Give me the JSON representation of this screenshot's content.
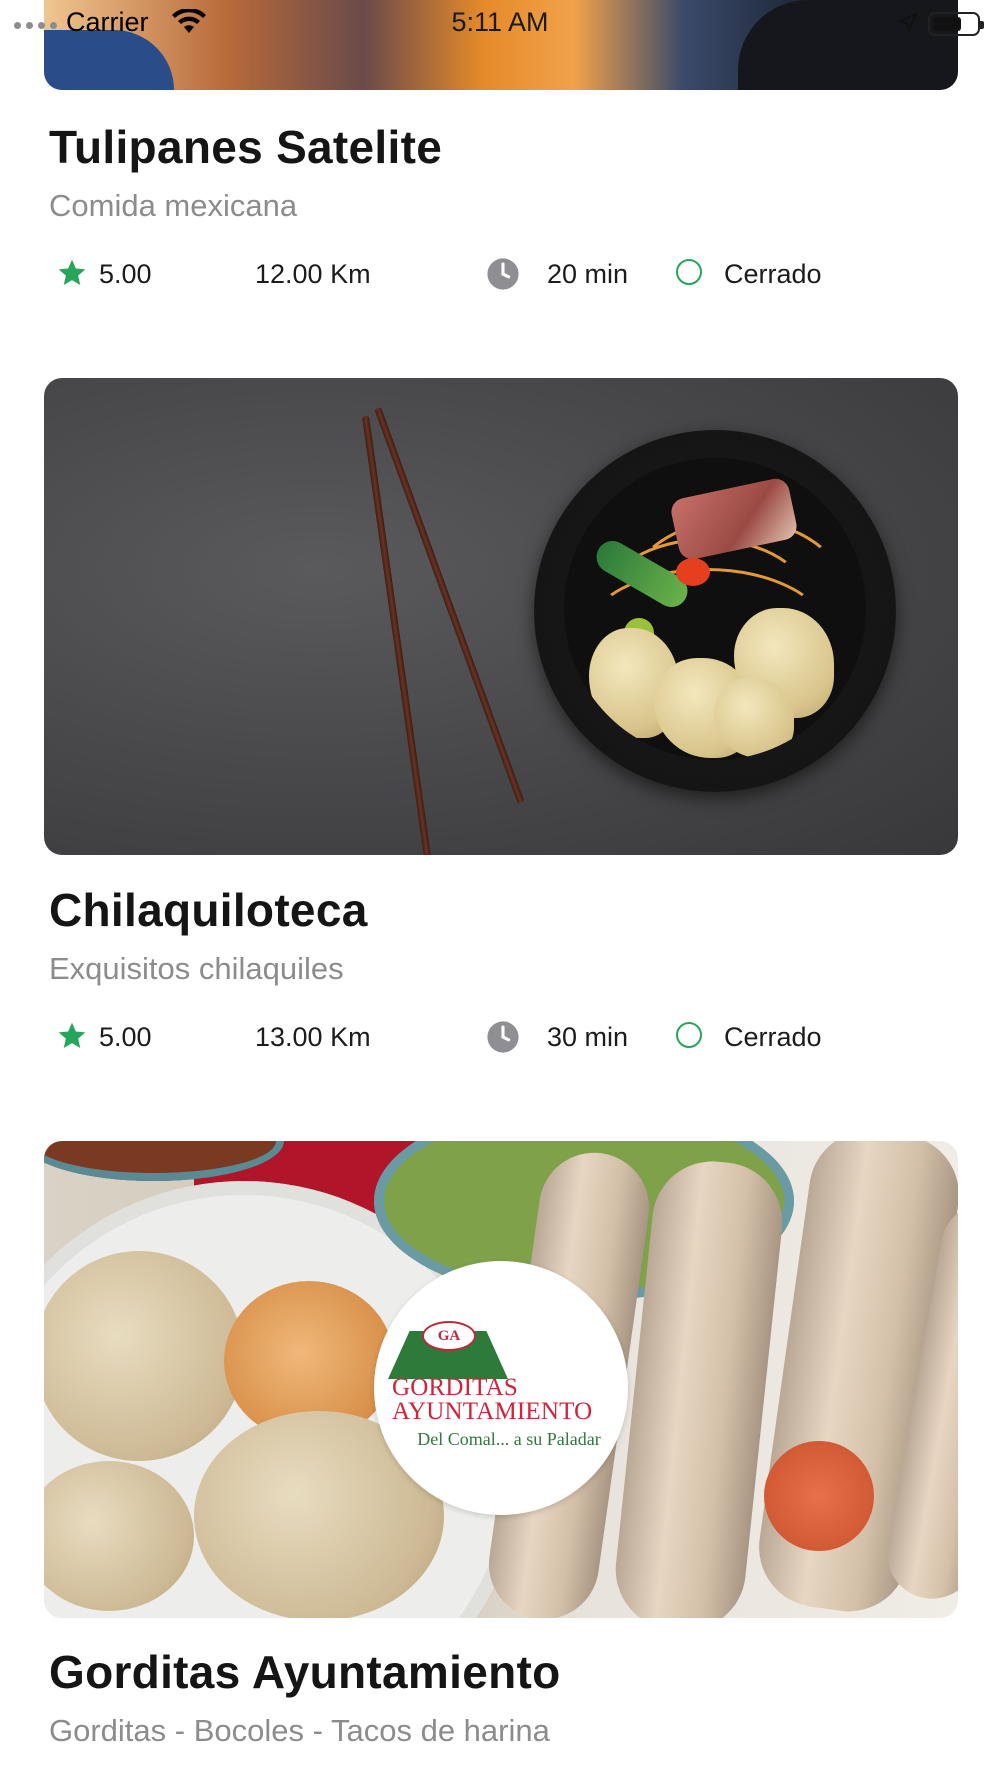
{
  "status_bar": {
    "carrier": "Carrier",
    "time": "5:11 AM",
    "icons": [
      "signal-dots-icon",
      "wifi-icon",
      "location-arrow-icon",
      "battery-icon"
    ]
  },
  "accent_color": "#27a55a",
  "restaurants": [
    {
      "name": "Tulipanes Satelite",
      "category": "Comida mexicana",
      "rating": "5.00",
      "distance": "12.00 Km",
      "time": "20 min",
      "status": "Cerrado"
    },
    {
      "name": "Chilaquiloteca",
      "category": "Exquisitos chilaquiles",
      "rating": "5.00",
      "distance": "13.00 Km",
      "time": "30 min",
      "status": "Cerrado"
    },
    {
      "name": "Gorditas Ayuntamiento",
      "category": "Gorditas - Bocoles - Tacos de harina",
      "logo": {
        "badge": "GA",
        "line1": "GORDITAS",
        "line2": "AYUNTAMIENTO",
        "tagline": "Del Comal... a su Paladar"
      }
    }
  ]
}
